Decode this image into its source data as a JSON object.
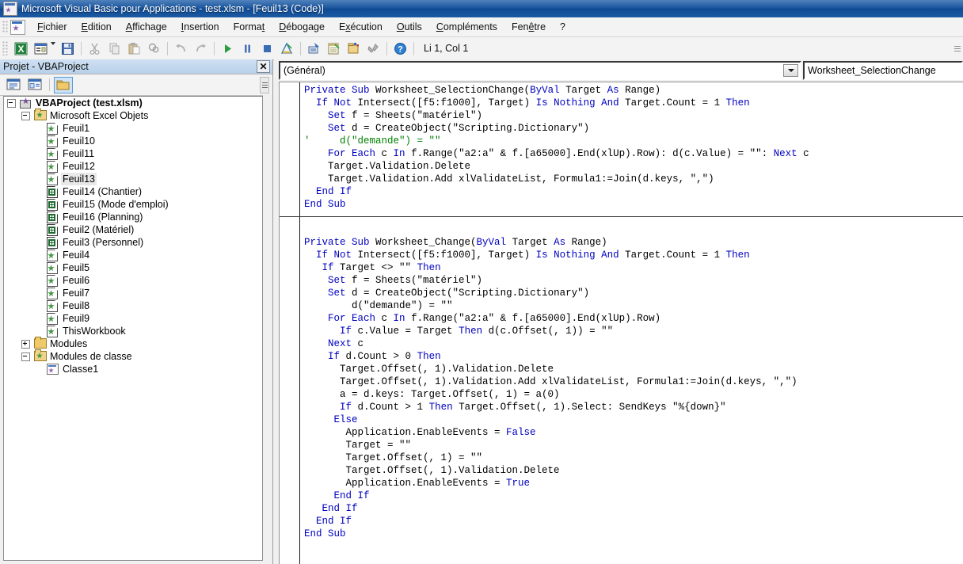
{
  "window": {
    "title": "Microsoft Visual Basic pour Applications - test.xlsm - [Feuil13 (Code)]",
    "app_icon": "vba-app-icon",
    "titlebar_color": "#14529c"
  },
  "menubar": {
    "app_icon": "vba-menu-icon",
    "items": [
      {
        "label": "Fichier",
        "accel": "F"
      },
      {
        "label": "Edition",
        "accel": "E"
      },
      {
        "label": "Affichage",
        "accel": "A"
      },
      {
        "label": "Insertion",
        "accel": "I"
      },
      {
        "label": "Format",
        "accel": "t"
      },
      {
        "label": "Débogage",
        "accel": "D"
      },
      {
        "label": "Exécution",
        "accel": "x"
      },
      {
        "label": "Outils",
        "accel": "O"
      },
      {
        "label": "Compléments",
        "accel": "C"
      },
      {
        "label": "Fenêtre",
        "accel": "ê"
      },
      {
        "label": "?",
        "accel": ""
      }
    ]
  },
  "toolbar": {
    "position_label": "Li 1, Col 1",
    "buttons": [
      {
        "name": "view-excel-icon",
        "tip": "Afficher Microsoft Excel"
      },
      {
        "name": "insert-userform-icon",
        "tip": "Insérer"
      },
      {
        "name": "dropdown-caret-icon",
        "tip": "Insérer (menu)"
      },
      {
        "name": "save-icon",
        "tip": "Enregistrer test.xlsm"
      },
      {
        "name": "cut-icon",
        "tip": "Couper"
      },
      {
        "name": "copy-icon",
        "tip": "Copier"
      },
      {
        "name": "paste-icon",
        "tip": "Coller"
      },
      {
        "name": "find-icon",
        "tip": "Rechercher"
      },
      {
        "name": "undo-icon",
        "tip": "Annuler"
      },
      {
        "name": "redo-icon",
        "tip": "Rétablir"
      },
      {
        "name": "run-icon",
        "tip": "Exécuter Sub/UserForm"
      },
      {
        "name": "pause-icon",
        "tip": "Interrompre"
      },
      {
        "name": "stop-icon",
        "tip": "Réinitialiser"
      },
      {
        "name": "design-mode-icon",
        "tip": "Mode création"
      },
      {
        "name": "project-explorer-icon",
        "tip": "Explorateur de projet"
      },
      {
        "name": "properties-window-icon",
        "tip": "Fenêtre Propriétés"
      },
      {
        "name": "object-browser-icon",
        "tip": "Explorateur d'objets"
      },
      {
        "name": "toolbox-icon",
        "tip": "Boîte à outils"
      },
      {
        "name": "help-icon",
        "tip": "Aide"
      }
    ]
  },
  "project_explorer": {
    "title": "Projet - VBAProject",
    "close_label": "✕",
    "toolbar_buttons": [
      {
        "name": "view-code-icon",
        "active": false
      },
      {
        "name": "view-object-icon",
        "active": false
      },
      {
        "name": "toggle-folders-icon",
        "active": true
      }
    ],
    "tree": [
      {
        "label": "VBAProject (test.xlsm)",
        "icon": "vbaproject-icon",
        "depth": 0,
        "toggle": "minus",
        "bold": true,
        "selected": false
      },
      {
        "label": "Microsoft Excel Objets",
        "icon": "excel-folder-icon",
        "depth": 1,
        "toggle": "minus",
        "bold": false,
        "selected": false
      },
      {
        "label": "Feuil1",
        "icon": "worksheet-icon",
        "depth": 2,
        "toggle": "none",
        "bold": false,
        "selected": false
      },
      {
        "label": "Feuil10",
        "icon": "worksheet-icon",
        "depth": 2,
        "toggle": "none",
        "bold": false,
        "selected": false
      },
      {
        "label": "Feuil11",
        "icon": "worksheet-icon",
        "depth": 2,
        "toggle": "none",
        "bold": false,
        "selected": false
      },
      {
        "label": "Feuil12",
        "icon": "worksheet-icon",
        "depth": 2,
        "toggle": "none",
        "bold": false,
        "selected": false
      },
      {
        "label": "Feuil13",
        "icon": "worksheet-icon",
        "depth": 2,
        "toggle": "none",
        "bold": false,
        "selected": true
      },
      {
        "label": "Feuil14 (Chantier)",
        "icon": "worksheet-grid-icon",
        "depth": 2,
        "toggle": "none",
        "bold": false,
        "selected": false
      },
      {
        "label": "Feuil15 (Mode d'emploi)",
        "icon": "worksheet-grid-icon",
        "depth": 2,
        "toggle": "none",
        "bold": false,
        "selected": false
      },
      {
        "label": "Feuil16 (Planning)",
        "icon": "worksheet-grid-icon",
        "depth": 2,
        "toggle": "none",
        "bold": false,
        "selected": false
      },
      {
        "label": "Feuil2 (Matériel)",
        "icon": "worksheet-grid-icon",
        "depth": 2,
        "toggle": "none",
        "bold": false,
        "selected": false
      },
      {
        "label": "Feuil3 (Personnel)",
        "icon": "worksheet-grid-icon",
        "depth": 2,
        "toggle": "none",
        "bold": false,
        "selected": false
      },
      {
        "label": "Feuil4",
        "icon": "worksheet-icon",
        "depth": 2,
        "toggle": "none",
        "bold": false,
        "selected": false
      },
      {
        "label": "Feuil5",
        "icon": "worksheet-icon",
        "depth": 2,
        "toggle": "none",
        "bold": false,
        "selected": false
      },
      {
        "label": "Feuil6",
        "icon": "worksheet-icon",
        "depth": 2,
        "toggle": "none",
        "bold": false,
        "selected": false
      },
      {
        "label": "Feuil7",
        "icon": "worksheet-icon",
        "depth": 2,
        "toggle": "none",
        "bold": false,
        "selected": false
      },
      {
        "label": "Feuil8",
        "icon": "worksheet-icon",
        "depth": 2,
        "toggle": "none",
        "bold": false,
        "selected": false
      },
      {
        "label": "Feuil9",
        "icon": "worksheet-icon",
        "depth": 2,
        "toggle": "none",
        "bold": false,
        "selected": false
      },
      {
        "label": "ThisWorkbook",
        "icon": "worksheet-icon",
        "depth": 2,
        "toggle": "none",
        "bold": false,
        "selected": false
      },
      {
        "label": "Modules",
        "icon": "folder-icon",
        "depth": 1,
        "toggle": "plus",
        "bold": false,
        "selected": false
      },
      {
        "label": "Modules de classe",
        "icon": "excel-folder-icon",
        "depth": 1,
        "toggle": "minus",
        "bold": false,
        "selected": false
      },
      {
        "label": "Classe1",
        "icon": "class-module-icon",
        "depth": 2,
        "toggle": "none",
        "bold": false,
        "selected": false
      }
    ]
  },
  "code_pane": {
    "object_combo": {
      "value": "(Général)",
      "name": "object-dropdown"
    },
    "procedure_combo": {
      "value": "Worksheet_SelectionChange",
      "name": "procedure-dropdown"
    },
    "procedures": [
      {
        "name": "Worksheet_SelectionChange",
        "lines": [
          [
            {
              "t": "Private Sub",
              "c": "kw"
            },
            {
              "t": " Worksheet_SelectionChange(",
              "c": "pl"
            },
            {
              "t": "ByVal",
              "c": "kw"
            },
            {
              "t": " Target ",
              "c": "pl"
            },
            {
              "t": "As",
              "c": "kw"
            },
            {
              "t": " Range)",
              "c": "pl"
            }
          ],
          [
            {
              "t": "  ",
              "c": "pl"
            },
            {
              "t": "If Not",
              "c": "kw"
            },
            {
              "t": " Intersect([f5:f1000], Target) ",
              "c": "pl"
            },
            {
              "t": "Is Nothing And",
              "c": "kw"
            },
            {
              "t": " Target.Count = 1 ",
              "c": "pl"
            },
            {
              "t": "Then",
              "c": "kw"
            }
          ],
          [
            {
              "t": "    ",
              "c": "pl"
            },
            {
              "t": "Set",
              "c": "kw"
            },
            {
              "t": " f = Sheets(\"matériel\")",
              "c": "pl"
            }
          ],
          [
            {
              "t": "    ",
              "c": "pl"
            },
            {
              "t": "Set",
              "c": "kw"
            },
            {
              "t": " d = CreateObject(\"Scripting.Dictionary\")",
              "c": "pl"
            }
          ],
          [
            {
              "t": "'     d(\"demande\") = \"\"",
              "c": "cmt"
            }
          ],
          [
            {
              "t": "    ",
              "c": "pl"
            },
            {
              "t": "For Each",
              "c": "kw"
            },
            {
              "t": " c ",
              "c": "pl"
            },
            {
              "t": "In",
              "c": "kw"
            },
            {
              "t": " f.Range(\"a2:a\" & f.[a65000].End(xlUp).Row): d(c.Value) = \"\": ",
              "c": "pl"
            },
            {
              "t": "Next",
              "c": "kw"
            },
            {
              "t": " c",
              "c": "pl"
            }
          ],
          [
            {
              "t": "    Target.Validation.Delete",
              "c": "pl"
            }
          ],
          [
            {
              "t": "    Target.Validation.Add xlValidateList, Formula1:=Join(d.keys, \",\")",
              "c": "pl"
            }
          ],
          [
            {
              "t": "  ",
              "c": "pl"
            },
            {
              "t": "End If",
              "c": "kw"
            }
          ],
          [
            {
              "t": "End Sub",
              "c": "kw"
            }
          ]
        ]
      },
      {
        "name": "Worksheet_Change",
        "lines": [
          [
            {
              "t": "",
              "c": "pl"
            }
          ],
          [
            {
              "t": "Private Sub",
              "c": "kw"
            },
            {
              "t": " Worksheet_Change(",
              "c": "pl"
            },
            {
              "t": "ByVal",
              "c": "kw"
            },
            {
              "t": " Target ",
              "c": "pl"
            },
            {
              "t": "As",
              "c": "kw"
            },
            {
              "t": " Range)",
              "c": "pl"
            }
          ],
          [
            {
              "t": "  ",
              "c": "pl"
            },
            {
              "t": "If Not",
              "c": "kw"
            },
            {
              "t": " Intersect([f5:f1000], Target) ",
              "c": "pl"
            },
            {
              "t": "Is Nothing And",
              "c": "kw"
            },
            {
              "t": " Target.Count = 1 ",
              "c": "pl"
            },
            {
              "t": "Then",
              "c": "kw"
            }
          ],
          [
            {
              "t": "   ",
              "c": "pl"
            },
            {
              "t": "If",
              "c": "kw"
            },
            {
              "t": " Target <> \"\" ",
              "c": "pl"
            },
            {
              "t": "Then",
              "c": "kw"
            }
          ],
          [
            {
              "t": "    ",
              "c": "pl"
            },
            {
              "t": "Set",
              "c": "kw"
            },
            {
              "t": " f = Sheets(\"matériel\")",
              "c": "pl"
            }
          ],
          [
            {
              "t": "    ",
              "c": "pl"
            },
            {
              "t": "Set",
              "c": "kw"
            },
            {
              "t": " d = CreateObject(\"Scripting.Dictionary\")",
              "c": "pl"
            }
          ],
          [
            {
              "t": "        d(\"demande\") = \"\"",
              "c": "pl"
            }
          ],
          [
            {
              "t": "    ",
              "c": "pl"
            },
            {
              "t": "For Each",
              "c": "kw"
            },
            {
              "t": " c ",
              "c": "pl"
            },
            {
              "t": "In",
              "c": "kw"
            },
            {
              "t": " f.Range(\"a2:a\" & f.[a65000].End(xlUp).Row)",
              "c": "pl"
            }
          ],
          [
            {
              "t": "      ",
              "c": "pl"
            },
            {
              "t": "If",
              "c": "kw"
            },
            {
              "t": " c.Value = Target ",
              "c": "pl"
            },
            {
              "t": "Then",
              "c": "kw"
            },
            {
              "t": " d(c.Offset(, 1)) = \"\"",
              "c": "pl"
            }
          ],
          [
            {
              "t": "    ",
              "c": "pl"
            },
            {
              "t": "Next",
              "c": "kw"
            },
            {
              "t": " c",
              "c": "pl"
            }
          ],
          [
            {
              "t": "    ",
              "c": "pl"
            },
            {
              "t": "If",
              "c": "kw"
            },
            {
              "t": " d.Count > 0 ",
              "c": "pl"
            },
            {
              "t": "Then",
              "c": "kw"
            }
          ],
          [
            {
              "t": "      Target.Offset(, 1).Validation.Delete",
              "c": "pl"
            }
          ],
          [
            {
              "t": "      Target.Offset(, 1).Validation.Add xlValidateList, Formula1:=Join(d.keys, \",\")",
              "c": "pl"
            }
          ],
          [
            {
              "t": "      a = d.keys: Target.Offset(, 1) = a(0)",
              "c": "pl"
            }
          ],
          [
            {
              "t": "      ",
              "c": "pl"
            },
            {
              "t": "If",
              "c": "kw"
            },
            {
              "t": " d.Count > 1 ",
              "c": "pl"
            },
            {
              "t": "Then",
              "c": "kw"
            },
            {
              "t": " Target.Offset(, 1).Select: SendKeys \"%{down}\"",
              "c": "pl"
            }
          ],
          [
            {
              "t": "     ",
              "c": "pl"
            },
            {
              "t": "Else",
              "c": "kw"
            }
          ],
          [
            {
              "t": "       Application.EnableEvents = ",
              "c": "pl"
            },
            {
              "t": "False",
              "c": "kw"
            }
          ],
          [
            {
              "t": "       Target = \"\"",
              "c": "pl"
            }
          ],
          [
            {
              "t": "       Target.Offset(, 1) = \"\"",
              "c": "pl"
            }
          ],
          [
            {
              "t": "       Target.Offset(, 1).Validation.Delete",
              "c": "pl"
            }
          ],
          [
            {
              "t": "       Application.EnableEvents = ",
              "c": "pl"
            },
            {
              "t": "True",
              "c": "kw"
            }
          ],
          [
            {
              "t": "     ",
              "c": "pl"
            },
            {
              "t": "End If",
              "c": "kw"
            }
          ],
          [
            {
              "t": "   ",
              "c": "pl"
            },
            {
              "t": "End If",
              "c": "kw"
            }
          ],
          [
            {
              "t": "  ",
              "c": "pl"
            },
            {
              "t": "End If",
              "c": "kw"
            }
          ],
          [
            {
              "t": "End Sub",
              "c": "kw"
            }
          ]
        ]
      }
    ]
  }
}
